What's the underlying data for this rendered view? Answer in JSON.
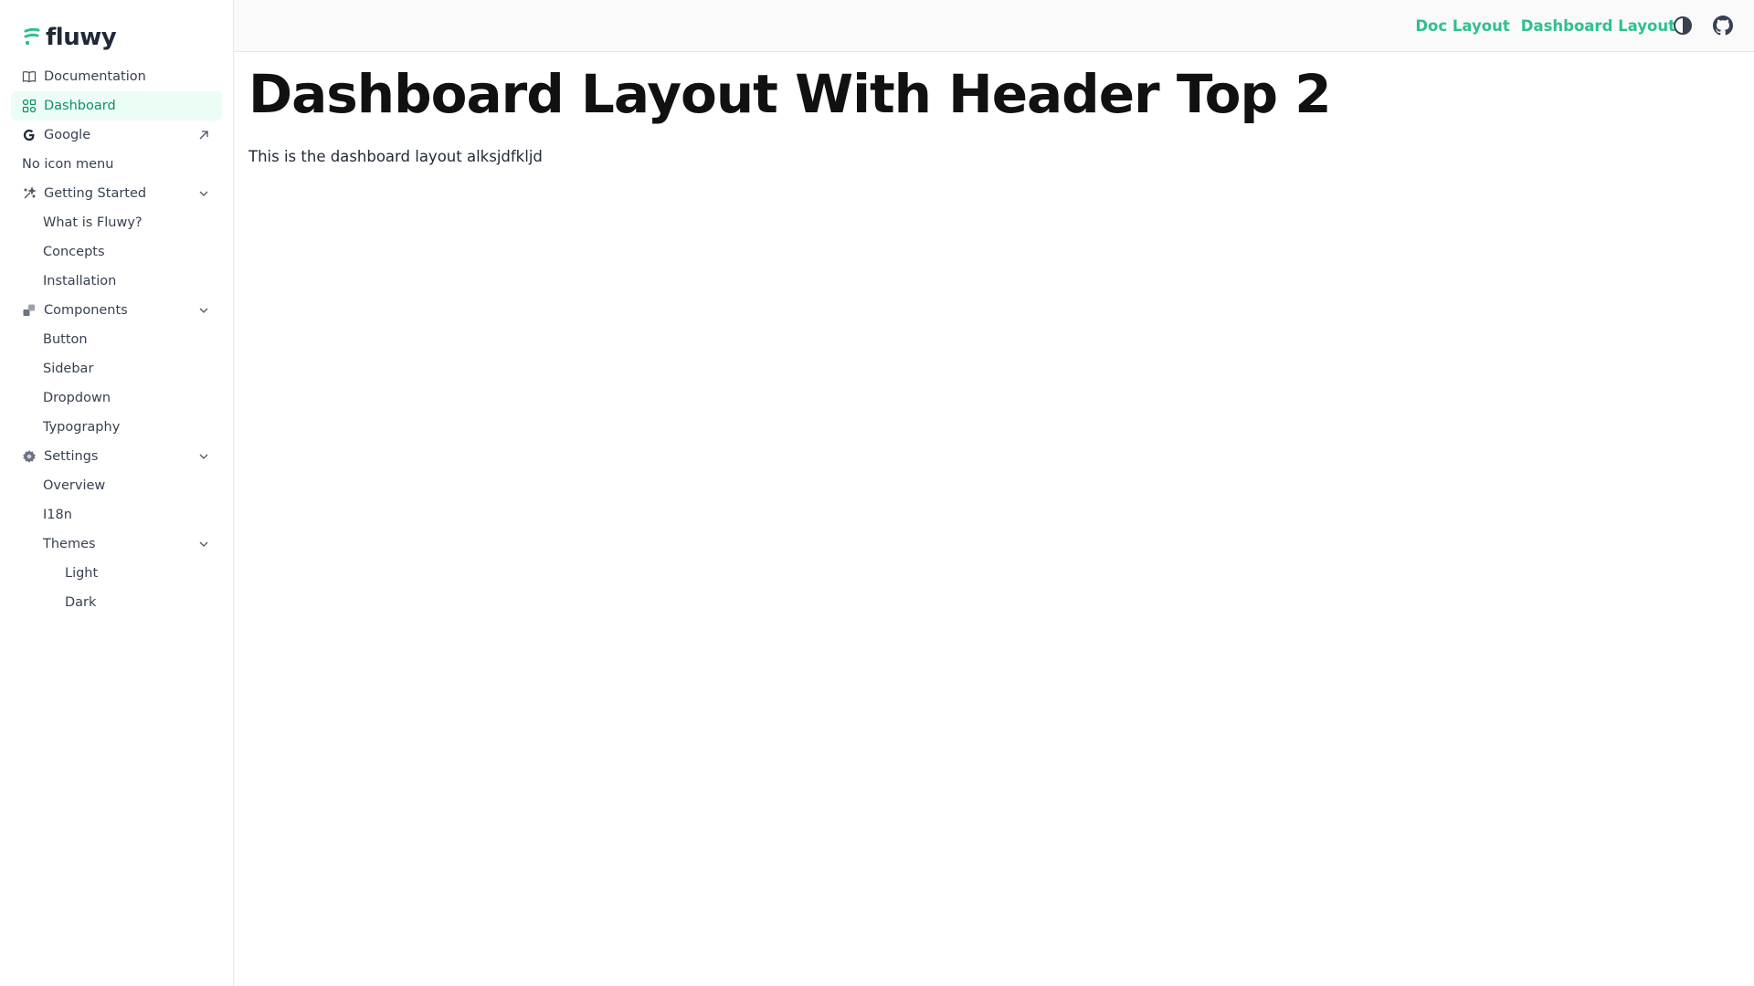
{
  "app": {
    "logo_text": "fluwy",
    "brand_color": "#2ec08e"
  },
  "sidebar": {
    "items": [
      {
        "label": "Documentation",
        "icon": "book-icon"
      },
      {
        "label": "Dashboard",
        "icon": "dashboard-grid-icon",
        "active": true
      },
      {
        "label": "Google",
        "icon": "google-icon",
        "right_icon": "external-link-icon"
      },
      {
        "label": "No icon menu"
      },
      {
        "label": "Getting Started",
        "icon": "sparkle-icon",
        "right_icon": "chevron-down-icon",
        "children": [
          "What is Fluwy?",
          "Concepts",
          "Installation"
        ]
      },
      {
        "label": "Components",
        "icon": "blocks-icon",
        "right_icon": "chevron-down-icon",
        "children": [
          "Button",
          "Sidebar",
          "Dropdown",
          "Typography"
        ]
      },
      {
        "label": "Settings",
        "icon": "gear-icon",
        "right_icon": "chevron-down-icon",
        "children": [
          "Overview",
          "I18n"
        ]
      },
      {
        "label": "Themes",
        "right_icon": "chevron-down-icon",
        "children": [
          "Light",
          "Dark"
        ]
      }
    ]
  },
  "header": {
    "links": [
      "Doc Layout",
      "Dashboard Layout"
    ],
    "icons": [
      "theme-toggle-icon",
      "github-icon"
    ]
  },
  "main": {
    "title": "Dashboard Layout With Header Top 2",
    "description": "This is the dashboard layout alksjdfkljd"
  }
}
